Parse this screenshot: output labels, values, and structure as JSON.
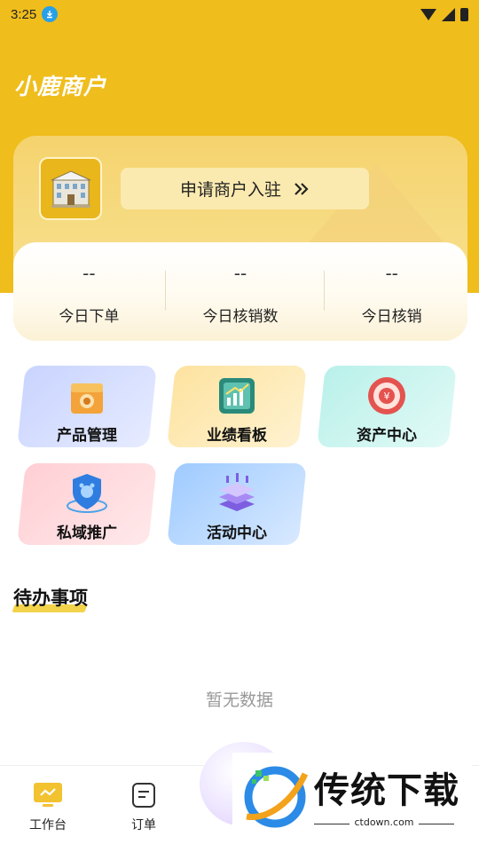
{
  "status_bar": {
    "time": "3:25"
  },
  "header": {
    "title": "小鹿商户"
  },
  "merchant_card": {
    "apply_label": "申请商户入驻",
    "stats": [
      {
        "value": "--",
        "label": "今日下单"
      },
      {
        "value": "--",
        "label": "今日核销数"
      },
      {
        "value": "--",
        "label": "今日核销"
      }
    ]
  },
  "menu": {
    "tiles": [
      {
        "label": "产品管理",
        "icon": "product-box-icon",
        "color": "#d8e1ff"
      },
      {
        "label": "业绩看板",
        "icon": "performance-board-icon",
        "color": "#fde9b3"
      },
      {
        "label": "资产中心",
        "icon": "asset-coin-icon",
        "color": "#c9f3f0"
      },
      {
        "label": "私域推广",
        "icon": "promotion-shield-icon",
        "color": "#ffd9dc"
      },
      {
        "label": "活动中心",
        "icon": "activity-stack-icon",
        "color": "#bfdcff"
      }
    ]
  },
  "todo": {
    "title": "待办事项",
    "empty_text": "暂无数据"
  },
  "tab_bar": {
    "tabs": [
      {
        "label": "工作台",
        "icon": "workbench-icon"
      },
      {
        "label": "订单",
        "icon": "order-icon"
      }
    ]
  },
  "watermark": {
    "text": "传统下载",
    "url": "ctdown.com"
  }
}
